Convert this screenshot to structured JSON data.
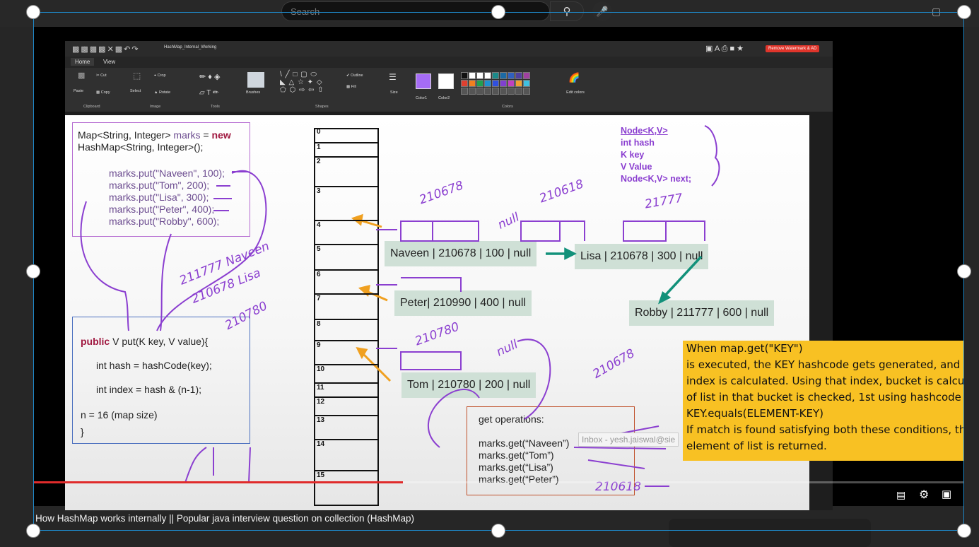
{
  "topbar": {
    "search_placeholder": "Search",
    "search_icon": "search-icon",
    "mic_icon": "mic-icon"
  },
  "paint": {
    "doc_title": "HashMap_Internal_Working",
    "watermark_button": "Remove Watermark & AD",
    "tabs": [
      "Home",
      "View"
    ],
    "ribbon": {
      "cut": "Cut",
      "copy": "Copy",
      "paste": "Paste",
      "select": "Select",
      "crop": "Crop",
      "rotate": "Rotate",
      "brushes": "Brushes",
      "outline": "Outline",
      "fill": "Fill",
      "size": "Size",
      "color1": "Color1",
      "color2": "Color2",
      "edit_colors": "Edit colors"
    },
    "groups": [
      "Clipboard",
      "Image",
      "Tools",
      "Shapes",
      "Colors"
    ]
  },
  "canvas": {
    "code_top": {
      "l1a": "Map<String, Integer> ",
      "l1b": "marks",
      "l1c": " = ",
      "l1d": "new",
      "l2": "HashMap<String, Integer>();",
      "puts": [
        "marks.put(\"Naveen\", 100);",
        "marks.put(\"Tom\", 200);",
        "marks.put(\"Lisa\", 300);",
        "marks.put(\"Peter\", 400);",
        "marks.put(\"Robby\", 600);"
      ]
    },
    "code_bottom": {
      "kw_public": "public",
      "sig": " V put(K key, V value){",
      "hash": "int hash = hashCode(key);",
      "index": "int index = hash & (n-1);",
      "n": "n = 16 (map size)",
      "close": "}"
    },
    "buckets": [
      "0",
      "1",
      "2",
      "3",
      "4",
      "5",
      "6",
      "7",
      "8",
      "9",
      "10",
      "11",
      "12",
      "13",
      "14",
      "15"
    ],
    "nodes": {
      "naveen": "Naveen | 210678 | 100 | null",
      "lisa": "Lisa | 210678 | 300 | null",
      "peter": "Peter| 210990 | 400 | null",
      "robby": "Robby | 211777 | 600 | null",
      "tom": "Tom | 210780 | 200 | null"
    },
    "node_class": [
      "Node<K,V>",
      "int hash",
      "K key",
      "V Value",
      "Node<K,V> next;"
    ],
    "get_ops": {
      "title": "get operations:",
      "lines": [
        "marks.get(“Naveen”)",
        "marks.get(“Tom”)",
        "marks.get(“Lisa”)",
        "marks.get(“Peter”)"
      ]
    },
    "handwriting": {
      "h1": "210678",
      "h2": "210618",
      "h3": "21777",
      "h4": "211777 Naveen",
      "h5": "210678 Lisa",
      "h6": "210780",
      "h7": "210780",
      "h8": "210678",
      "h9": "210618",
      "h10": "null",
      "h11": "null"
    }
  },
  "note": {
    "lines": [
      "When map.get(\"KEY\")",
      "is executed, the KEY hashcode gets generated, and u",
      "index is calculated. Using that index, bucket is calcul",
      "of list in that bucket is checked, 1st using hashcode o",
      "KEY.equals(ELEMENT-KEY)",
      "If match is found satisfying both these conditions, th",
      "element of list is returned."
    ]
  },
  "inbox_tooltip": "Inbox - yesh.jaiswal@sie",
  "video": {
    "title": "How HashMap works internally || Popular java interview question on collection (HashMap)",
    "progress": 0.397
  },
  "colors": {
    "accent_purple": "#8b3fd0",
    "node_green": "#cfe0d6",
    "note_yellow": "#f8c123",
    "progress_red": "#e02b2b",
    "selection_blue": "#1e88c8"
  }
}
